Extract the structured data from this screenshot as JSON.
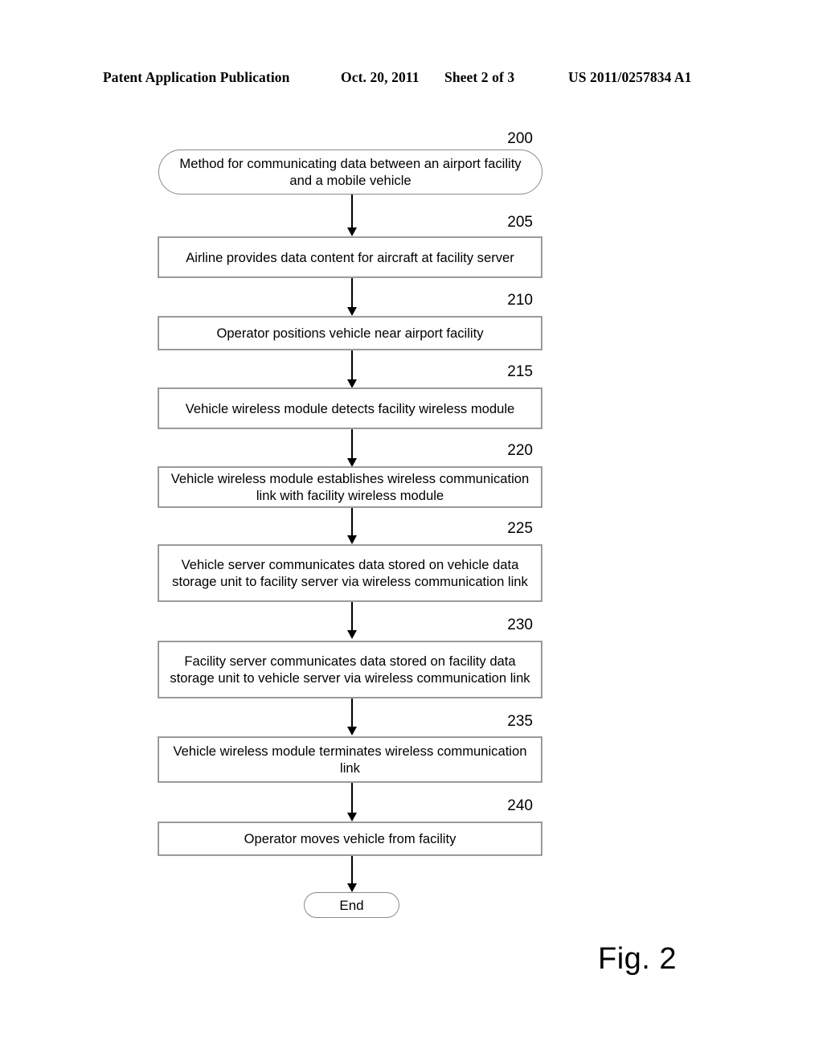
{
  "header": {
    "title": "Patent Application Publication",
    "date": "Oct. 20, 2011",
    "sheet": "Sheet 2 of 3",
    "publication_number": "US 2011/0257834 A1"
  },
  "figure": {
    "caption": "Fig. 2",
    "colors": {
      "box_border": "#8f8f8f",
      "text": "#000000",
      "background": "#ffffff",
      "arrow": "#000000"
    }
  },
  "flowchart": {
    "nodes": [
      {
        "ref": "200",
        "shape": "stadium",
        "text": "Method for communicating data between an airport facility and a mobile vehicle"
      },
      {
        "ref": "205",
        "shape": "rect",
        "text": "Airline provides data content for aircraft at facility server"
      },
      {
        "ref": "210",
        "shape": "rect",
        "text": "Operator positions vehicle near airport facility"
      },
      {
        "ref": "215",
        "shape": "rect",
        "text": "Vehicle wireless module detects facility wireless module"
      },
      {
        "ref": "220",
        "shape": "rect",
        "text": "Vehicle wireless module establishes wireless communication link with facility wireless module"
      },
      {
        "ref": "225",
        "shape": "rect",
        "text": "Vehicle server communicates data stored on vehicle data storage unit to facility server via wireless communication link"
      },
      {
        "ref": "230",
        "shape": "rect",
        "text": "Facility server communicates data stored on facility data storage unit to vehicle server via wireless communication link"
      },
      {
        "ref": "235",
        "shape": "rect",
        "text": "Vehicle wireless module terminates wireless communication link"
      },
      {
        "ref": "240",
        "shape": "rect",
        "text": "Operator moves vehicle from facility"
      },
      {
        "ref": "",
        "shape": "stadium",
        "text": "End"
      }
    ]
  }
}
